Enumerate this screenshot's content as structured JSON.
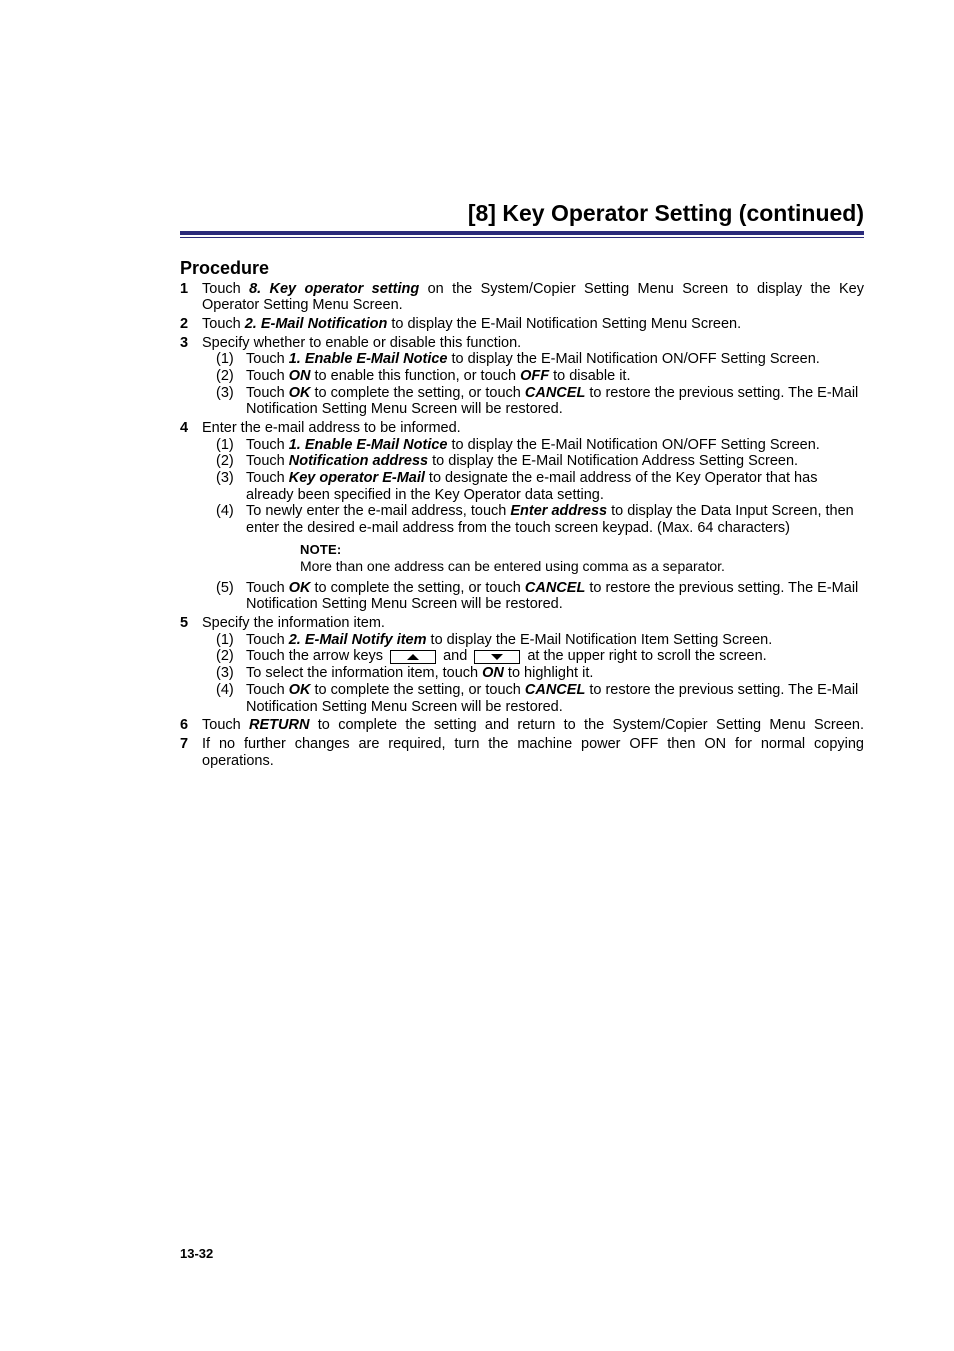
{
  "header": {
    "title": "[8] Key Operator Setting (continued)"
  },
  "procedure": {
    "heading": "Procedure",
    "steps": [
      {
        "num": "1",
        "pre": "Touch ",
        "term": "8. Key operator setting",
        "post": " on the System/Copier Setting Menu Screen to display the Key Operator Setting Menu Screen."
      },
      {
        "num": "2",
        "pre": "Touch ",
        "term": "2. E-Mail Notification",
        "post": " to display the E-Mail Notification Setting Menu Screen."
      },
      {
        "num": "3",
        "text": "Specify whether to enable or disable this function.",
        "sub": [
          {
            "n": "(1)",
            "pre": "Touch ",
            "term": "1. Enable E-Mail Notice",
            "post": " to display the E-Mail Notification ON/OFF Setting Screen."
          },
          {
            "n": "(2)",
            "segments": [
              {
                "t": "Touch "
              },
              {
                "bi": "ON"
              },
              {
                "t": " to enable this function, or touch "
              },
              {
                "bi": "OFF"
              },
              {
                "t": " to disable it."
              }
            ]
          },
          {
            "n": "(3)",
            "segments": [
              {
                "t": "Touch "
              },
              {
                "bi": "OK"
              },
              {
                "t": " to complete the setting, or touch "
              },
              {
                "bi": "CANCEL"
              },
              {
                "t": " to restore the previous setting. The E-Mail Notification Setting Menu Screen will be restored."
              }
            ]
          }
        ]
      },
      {
        "num": "4",
        "text": "Enter the e-mail address to be informed.",
        "sub": [
          {
            "n": "(1)",
            "pre": "Touch ",
            "term": "1. Enable E-Mail Notice",
            "post": " to display the E-Mail Notification ON/OFF Setting Screen."
          },
          {
            "n": "(2)",
            "pre": "Touch ",
            "term": "Notification address",
            "post": " to display the E-Mail Notification Address Setting Screen."
          },
          {
            "n": "(3)",
            "pre": "Touch ",
            "term": "Key operator E-Mail",
            "post": " to designate the e-mail address of the Key Operator that has already been specified in the Key Operator data setting."
          },
          {
            "n": "(4)",
            "segments": [
              {
                "t": "To newly enter the e-mail address, touch "
              },
              {
                "bi": "Enter address"
              },
              {
                "t": " to display the Data Input Screen, then enter the desired e-mail address from the touch screen keypad. (Max. 64 characters)"
              }
            ]
          }
        ],
        "note": {
          "label": "NOTE:",
          "text": "More than one address can be entered using comma as a separator."
        },
        "sub2": [
          {
            "n": "(5)",
            "segments": [
              {
                "t": "Touch "
              },
              {
                "bi": "OK"
              },
              {
                "t": " to complete the setting, or touch "
              },
              {
                "bi": "CANCEL"
              },
              {
                "t": " to restore the previous setting. The E-Mail Notification Setting Menu Screen will be restored."
              }
            ]
          }
        ]
      },
      {
        "num": "5",
        "text": "Specify the information item.",
        "sub": [
          {
            "n": "(1)",
            "pre": "Touch ",
            "term": "2. E-Mail Notify item",
            "post": " to display the E-Mail Notification Item Setting Screen."
          },
          {
            "n": "(2)",
            "arrowText": {
              "pre": "Touch the arrow keys ",
              "mid": " and ",
              "post": " at the upper right to scroll the screen."
            }
          },
          {
            "n": "(3)",
            "segments": [
              {
                "t": "To select the information item, touch "
              },
              {
                "bi": "ON"
              },
              {
                "t": " to highlight it."
              }
            ]
          },
          {
            "n": "(4)",
            "segments": [
              {
                "t": "Touch "
              },
              {
                "bi": "OK"
              },
              {
                "t": " to complete the setting, or touch "
              },
              {
                "bi": "CANCEL"
              },
              {
                "t": " to restore the previous setting. The E-Mail Notification Setting Menu Screen will be restored."
              }
            ]
          }
        ]
      },
      {
        "num": "6",
        "segments": [
          {
            "t": "Touch "
          },
          {
            "bi": "RETURN"
          },
          {
            "t": " to complete the setting and return to the System/Copier Setting Menu Screen."
          }
        ],
        "justifyFull": true
      },
      {
        "num": "7",
        "text": "If no further changes are required, turn the machine power OFF then ON for normal copying operations."
      }
    ]
  },
  "pageNumber": "13-32"
}
